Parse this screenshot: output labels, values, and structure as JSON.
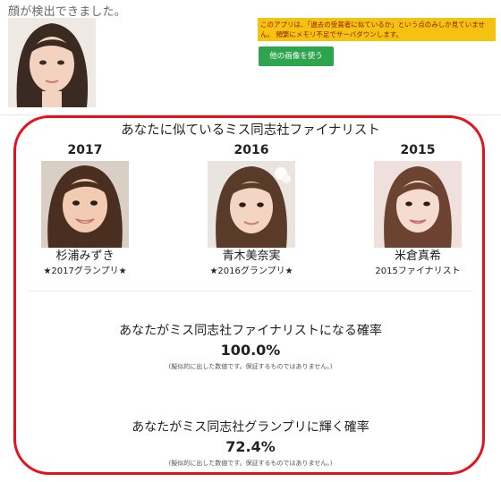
{
  "header": {
    "detected_text": "顔が検出できました。",
    "notice_text": "このアプリは、「過去の受賞者に似ているか」という点のみしか見ていません。 頻繁にメモリ不足でサーバダウンします。",
    "other_image_button": "他の画像を使う"
  },
  "finalists": {
    "title": "あなたに似ているミス同志社ファイナリスト",
    "items": [
      {
        "year": "2017",
        "name": "杉浦みずき",
        "award": "★2017グランプリ★"
      },
      {
        "year": "2016",
        "name": "青木美奈実",
        "award": "★2016グランプリ★"
      },
      {
        "year": "2015",
        "name": "米倉真希",
        "award": "2015ファイナリスト"
      }
    ]
  },
  "probabilities": [
    {
      "heading": "あなたがミス同志社ファイナリストになる確率",
      "value": "100.0%",
      "note": "(擬似的に出した数値です。保証するものではありません。)"
    },
    {
      "heading": "あなたがミス同志社グランプリに輝く確率",
      "value": "72.4%",
      "note": "(擬似的に出した数値です。保証するものではありません。)"
    }
  ],
  "colors": {
    "notice_bg": "#f5c211",
    "button_green": "#2ea44f",
    "highlight_red": "#e8101c"
  }
}
